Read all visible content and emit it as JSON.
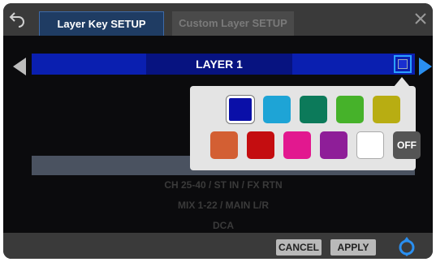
{
  "tabs": [
    {
      "label": "Layer Key SETUP",
      "active": true
    },
    {
      "label": "Custom Layer SETUP",
      "active": false
    }
  ],
  "layer": {
    "name": "LAYER 1",
    "color": "#0a1fb0"
  },
  "color_palette": {
    "row1": [
      "#0a0fa8",
      "#1ea4d6",
      "#0c7a5a",
      "#46b22a",
      "#b8ad12"
    ],
    "row2": [
      "#d35f33",
      "#c40d10",
      "#e2188f",
      "#8e1e98",
      "#ffffff"
    ],
    "off_label": "OFF",
    "selected": "#0a0fa8"
  },
  "list": [
    "CH 25-40 / ST IN / FX RTN",
    "MIX 1-22 / MAIN L/R",
    "DCA"
  ],
  "footer": {
    "cancel": "CANCEL",
    "apply": "APPLY"
  }
}
